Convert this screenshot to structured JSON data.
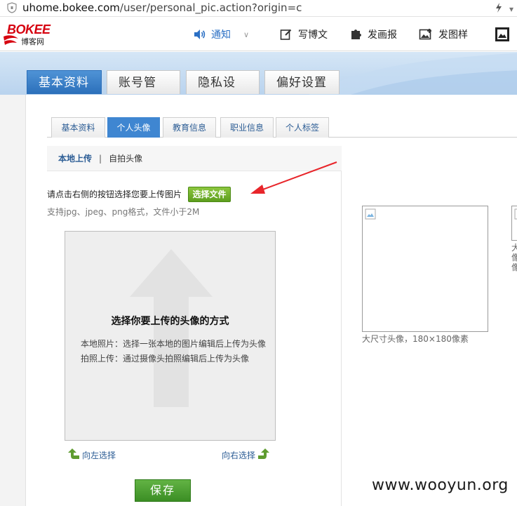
{
  "browser": {
    "url_host": "uhome.bokee.com",
    "url_path": "/user/personal_pic.action?origin=c"
  },
  "header": {
    "logo_text": "BOKEE",
    "logo_subtitle": "博客网",
    "nav": {
      "notify": "通知",
      "write_blog": "写博文",
      "publish_pic": "发画报",
      "publish_image": "发图样",
      "more_icon": "image-frame-icon"
    }
  },
  "main_tabs": [
    "基本资料",
    "账号管理",
    "隐私设置",
    "偏好设置"
  ],
  "sub_tabs": [
    "基本资料",
    "个人头像",
    "教育信息",
    "职业信息",
    "个人标签"
  ],
  "upload_mode": {
    "local": "本地上传",
    "separator": "|",
    "self_shot": "自拍头像"
  },
  "upload": {
    "instruction": "请点击右侧的按钮选择您要上传图片",
    "choose_button": "选择文件",
    "support_text": "支持jpg、jpeg、png格式，文件小于2M"
  },
  "preview": {
    "title": "选择你要上传的头像的方式",
    "line1": "本地照片：选择一张本地的图片编辑后上传为头像",
    "line2": "拍照上传：通过摄像头拍照编辑后上传为头像"
  },
  "rotate": {
    "left": "向左选择",
    "right": "向右选择"
  },
  "save_button": "保存",
  "avatar_preview": {
    "large_label": "大尺寸头像，180×180像素",
    "mid_label": "大像像"
  },
  "watermark": "www.wooyun.org",
  "colors": {
    "active_tab": "#2b6fba",
    "link": "#2c5d95",
    "green_button": "#5d9e1d",
    "brand_red": "#d6000f",
    "annotation_arrow": "#e8252a"
  }
}
